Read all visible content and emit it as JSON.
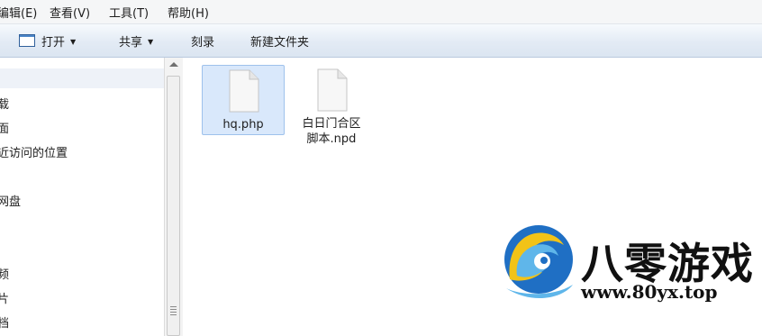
{
  "menubar": {
    "items": [
      {
        "label": "编辑(E)"
      },
      {
        "label": "查看(V)"
      },
      {
        "label": "工具(T)"
      },
      {
        "label": "帮助(H)"
      }
    ]
  },
  "toolbar": {
    "open_label": "打开",
    "share_label": "共享",
    "burn_label": "刻录",
    "new_folder_label": "新建文件夹"
  },
  "nav": {
    "items": [
      {
        "label": "夹"
      },
      {
        "label": "载"
      },
      {
        "label": "面"
      },
      {
        "label": "近访问的位置"
      },
      {
        "label": "网盘"
      },
      {
        "label": "频"
      },
      {
        "label": "片"
      },
      {
        "label": "档"
      }
    ]
  },
  "files": [
    {
      "name": "hq.php",
      "selected": true,
      "icon": "document-icon"
    },
    {
      "name_line1": "白日门合区",
      "name_line2": "脚本.npd",
      "selected": false,
      "icon": "document-icon"
    }
  ],
  "watermark": {
    "title": "八零游戏",
    "url": "www.80yx.top",
    "logo": "wave-circle-logo",
    "colors": {
      "blue": "#1f6fc4",
      "yellow": "#f2c318",
      "light_blue": "#5fb6ea"
    }
  }
}
